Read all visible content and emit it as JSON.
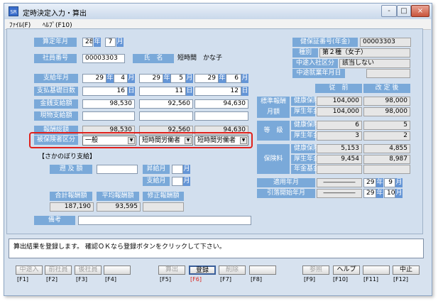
{
  "window": {
    "title": "定時決定入力・算出",
    "icon_text": "SR",
    "min": "-",
    "max": "□",
    "close": "×"
  },
  "menu": {
    "file": "ﾌｧｲﾙ(F)",
    "help": "ﾍﾙﾌﾟ(F10)"
  },
  "form": {
    "year_label": "算定年月",
    "year_value": "28",
    "year_unit": "年",
    "month_value": "7",
    "month_unit": "月",
    "employee_no_label": "社員番号",
    "employee_no_value": "00003303",
    "name_label": "氏　名",
    "name_value": "短時間　かな子",
    "pay_month_label": "支給年月",
    "pay_months": [
      {
        "year": "29",
        "y_unit": "年",
        "month": "4",
        "m_unit": "月"
      },
      {
        "year": "29",
        "y_unit": "年",
        "month": "5",
        "m_unit": "月"
      },
      {
        "year": "29",
        "y_unit": "年",
        "month": "6",
        "m_unit": "月"
      }
    ],
    "base_days_label": "支払基礎日数",
    "base_days": [
      "16",
      "11",
      "12"
    ],
    "day_unit": "日",
    "cash_label": "金銭支給額",
    "cash": [
      "98,530",
      "92,560",
      "94,630"
    ],
    "kind_label": "現物支給額",
    "total_label": "報酬総額",
    "total": [
      "98,530",
      "92,560",
      "94,630"
    ],
    "insured_class_label": "被保険者区分",
    "insured_class": [
      "一般",
      "短時間労働者",
      "短時間労働者"
    ],
    "retro_section": "【さかのぼり支給】",
    "retro_amount_label": "遡 及 額",
    "up_month_label": "昇給月",
    "pay_month2_label": "支給月",
    "sum_label": "合計報酬額",
    "sum_value": "187,190",
    "avg_label": "平均報酬額",
    "avg_value": "93,595",
    "corrected_label": "修正報酬額",
    "remarks_label": "備考"
  },
  "right": {
    "insurance_no_label": "健保証番号(年金)",
    "insurance_no_value": "00003303",
    "type_label": "種別",
    "type_value": "第２種（女子）",
    "midjoin_label": "中途入社区分",
    "midjoin_value": "該当しない",
    "midemp_label": "中途就業年月日",
    "before_label": "従　前",
    "after_label": "改 定 後",
    "std_label1": "標準報酬",
    "std_label2": "月額",
    "health_label": "健康保険",
    "pension_label": "厚生年金",
    "fund_label": "年金基金",
    "std_health": [
      "104,000",
      "98,000"
    ],
    "std_pension": [
      "104,000",
      "98,000"
    ],
    "grade_label": "等　級",
    "grade_health": [
      "6",
      "5"
    ],
    "grade_pension": [
      "3",
      "2"
    ],
    "premium_label": "保険料",
    "premium_health": [
      "5,153",
      "4,855"
    ],
    "premium_pension": [
      "9,454",
      "8,987"
    ],
    "apply_label": "適用年月",
    "apply_dash": "―――――",
    "apply_year": "29",
    "apply_month": "9",
    "deduct_label": "引落開始年月",
    "deduct_dash": "―――――",
    "deduct_year": "29",
    "deduct_month": "10",
    "year_unit": "年",
    "month_unit": "月"
  },
  "message": "算出結果を登録します。 確認ＯＫなら登録ボタンをクリックして下さい。",
  "buttons": [
    {
      "label": "中途入",
      "key": "[F1]"
    },
    {
      "label": "前社員",
      "key": "[F2]"
    },
    {
      "label": "後社員",
      "key": "[F3]"
    },
    {
      "label": "",
      "key": "[F4]"
    },
    {
      "label": "算出",
      "key": "[F5]"
    },
    {
      "label": "登録",
      "key": "[F6]"
    },
    {
      "label": "削除",
      "key": "[F7]"
    },
    {
      "label": "",
      "key": "[F8]"
    },
    {
      "label": "参照",
      "key": "[F9]"
    },
    {
      "label": "ヘルプ",
      "key": "[F10]"
    },
    {
      "label": "",
      "key": "[F11]"
    },
    {
      "label": "中止",
      "key": "[F12]"
    }
  ],
  "colors": {
    "label_bg": "#7aa9d9",
    "unit_bg": "#6495d6",
    "highlight": "#e0211c",
    "panel": "#d2dfee"
  }
}
